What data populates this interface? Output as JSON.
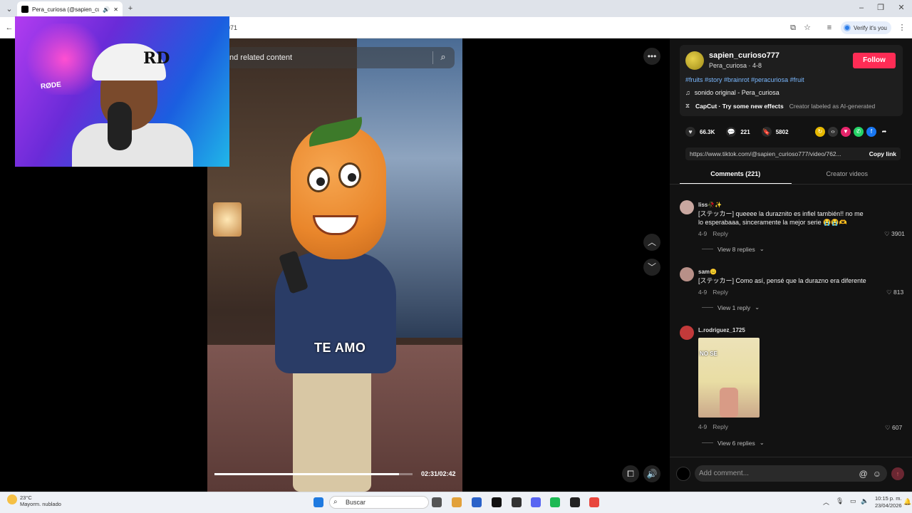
{
  "browser": {
    "tab_title": "Pera_curiosa (@sapien_curi",
    "url": "071",
    "verify_label": "Verify it's you"
  },
  "webcam": {
    "mic_brand": "RØDE"
  },
  "video": {
    "search_placeholder": "nd related content",
    "caption": "TE AMO",
    "timecode": "02:31/02:42",
    "progress": 0.93
  },
  "creator": {
    "username": "sapien_curioso777",
    "subline": "Pera_curiosa · 4-8",
    "follow_label": "Follow",
    "hashtags": "#fruits #story #brainrot #peracuriosa #fruit",
    "sound": "sonido original - Pera_curiosa",
    "effect": "CapCut · Try some new effects",
    "ai_label": "Creator labeled as AI-generated"
  },
  "stats": {
    "likes": "66.3K",
    "comments": "221",
    "saves": "5802"
  },
  "share_link": {
    "url": "https://www.tiktok.com/@sapien_curioso777/video/762...",
    "copy_label": "Copy link"
  },
  "tabs": {
    "comments": "Comments (221)",
    "creator_videos": "Creator videos"
  },
  "comments": [
    {
      "name": "liss🥀✨",
      "text_line1": "[ステッカー] queeee la duraznito es infiel también!! no me",
      "text_line2": "lo esperabaaa, sinceramente la mejor serie 😭😭🫶",
      "date": "4-9",
      "reply_label": "Reply",
      "likes": "3901",
      "replies": "View 8 replies"
    },
    {
      "name": "sam😑",
      "text_line1": "[ステッカー] Como así, pensé que la durazno era diferente",
      "date": "4-9",
      "reply_label": "Reply",
      "likes": "813",
      "replies": "View 1 reply"
    },
    {
      "name": "L.rodriguez_1725",
      "image_text": "NO SE",
      "date": "4-9",
      "reply_label": "Reply",
      "likes": "607",
      "replies": "View 6 replies"
    }
  ],
  "add_comment_placeholder": "Add comment...",
  "taskbar": {
    "temp": "23°C",
    "weather": "Mayorm. nublado",
    "search": "Buscar",
    "time": "10:15 p. m.",
    "date": "23/04/2026"
  },
  "colors": {
    "follow": "#fe2c55",
    "hashtag": "#7ab8ff",
    "panel_bg": "#121212"
  }
}
